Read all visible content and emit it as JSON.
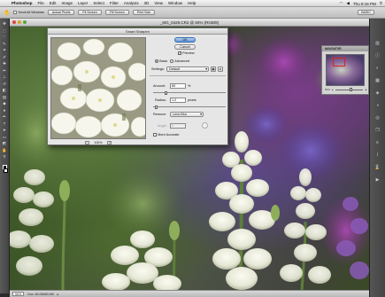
{
  "menubar": {
    "items": [
      "Photoshop",
      "File",
      "Edit",
      "Image",
      "Layer",
      "Select",
      "Filter",
      "Analysis",
      "3D",
      "View",
      "Window",
      "Help"
    ],
    "clock": "Thu 8:16 PM"
  },
  "options": {
    "scroll_all_windows": "Scroll All Windows",
    "buttons": [
      "Actual Pixels",
      "Fit Screen",
      "Fill Screen",
      "Print Size"
    ],
    "workspace": "BASIC"
  },
  "document": {
    "title": "_MG_0429.CR2 @ 50% (RGB/8)",
    "status_zoom": "50%",
    "status_doc": "Doc: 60.0M/60.0M"
  },
  "navigator": {
    "tab": "NAVIGATOR",
    "zoom": "50%"
  },
  "dialog": {
    "title": "Smart Sharpen",
    "ok": "OK",
    "cancel": "Cancel",
    "preview_label": "Preview",
    "basic_label": "Basic",
    "advanced_label": "Advanced",
    "settings_label": "Settings:",
    "settings_value": "Default",
    "amount_label": "Amount:",
    "amount_value": "85",
    "amount_unit": "%",
    "amount_fraction": 0.17,
    "radius_label": "Radius:",
    "radius_value": "1.0",
    "radius_unit": "pixels",
    "radius_fraction": 0.02,
    "remove_label": "Remove:",
    "remove_value": "Lens Blur",
    "angle_label": "Angle:",
    "angle_value": "0",
    "more_accurate_label": "More Accurate",
    "preview_zoom": "100%"
  }
}
